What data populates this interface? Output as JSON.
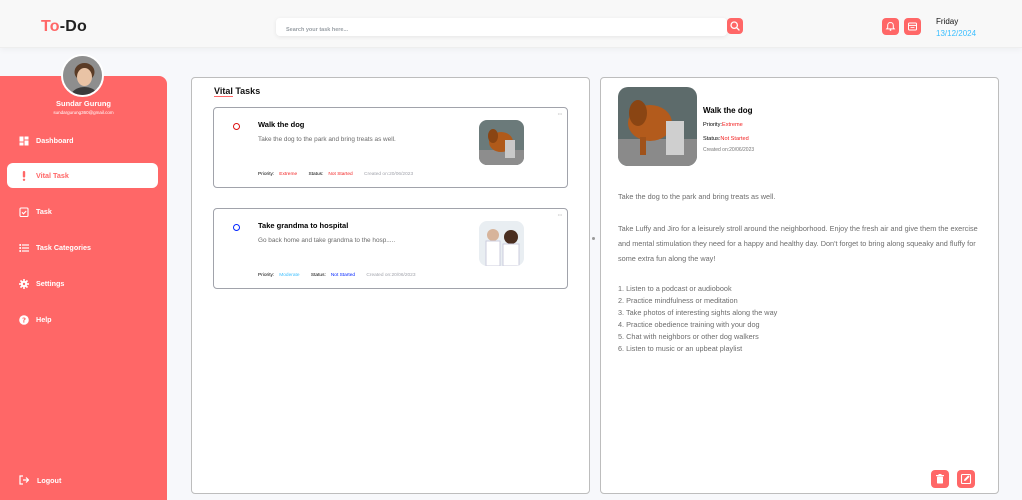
{
  "app": {
    "logo_a": "To",
    "logo_b": "-Do"
  },
  "search": {
    "placeholder": "Search your task here..."
  },
  "header": {
    "day": "Friday",
    "date": "13/12/2024"
  },
  "user": {
    "name": "Sundar Gurung",
    "email": "sundargurung360@gmail.com"
  },
  "nav": [
    {
      "label": "Dashboard",
      "icon": "dashboard-icon"
    },
    {
      "label": "Vital Task",
      "icon": "exclamation-icon"
    },
    {
      "label": "Task",
      "icon": "checklist-icon"
    },
    {
      "label": "Task Categories",
      "icon": "list-icon"
    },
    {
      "label": "Settings",
      "icon": "gear-icon"
    },
    {
      "label": "Help",
      "icon": "help-icon"
    }
  ],
  "logout": {
    "label": "Logout",
    "icon": "logout-icon"
  },
  "vital": {
    "title_a": "Vital",
    "title_b": " Tasks",
    "tasks": [
      {
        "title": "Walk the dog",
        "desc": "Take the dog to the park and bring treats as well.",
        "priority_label": "Priority:",
        "priority": "Extreme",
        "status_label": "Status:",
        "status": "Not Started",
        "created": "Created on:20/06/2023",
        "status_color": "#d11"
      },
      {
        "title": "Take grandma to hospital",
        "desc": "Go back home and take grandma to the hosp.....",
        "priority_label": "Priority:",
        "priority": "Moderate",
        "status_label": "Status:",
        "status": "Not Started",
        "created": "Created on:20/06/2023",
        "status_color": "#0225ff"
      }
    ]
  },
  "detail": {
    "title": "Walk the dog",
    "priority_label": "Priority:",
    "priority": "Extreme",
    "status_label": "Status:",
    "status": "Not Started",
    "created": "Created on:20/06/2023",
    "summary": "Take the dog to the park and bring treats as well.",
    "body": "Take Luffy and Jiro for a leisurely stroll around the neighborhood. Enjoy the fresh air and give them the exercise and mental stimulation they need for a happy and healthy day. Don't forget to bring along squeaky and fluffy for some extra fun along the way!",
    "list": [
      "1. Listen to a podcast or audiobook",
      "2. Practice mindfulness or meditation",
      "3. Take photos of interesting sights along the way",
      "4. Practice obedience training with your dog",
      "5. Chat with neighbors or other dog walkers",
      "6. Listen to music or an upbeat playlist"
    ]
  },
  "colors": {
    "accent": "#ff6767",
    "date": "#3abeff",
    "extreme": "#f21e1e",
    "moderate": "#3abeff",
    "not_started": "#f21e1e"
  }
}
